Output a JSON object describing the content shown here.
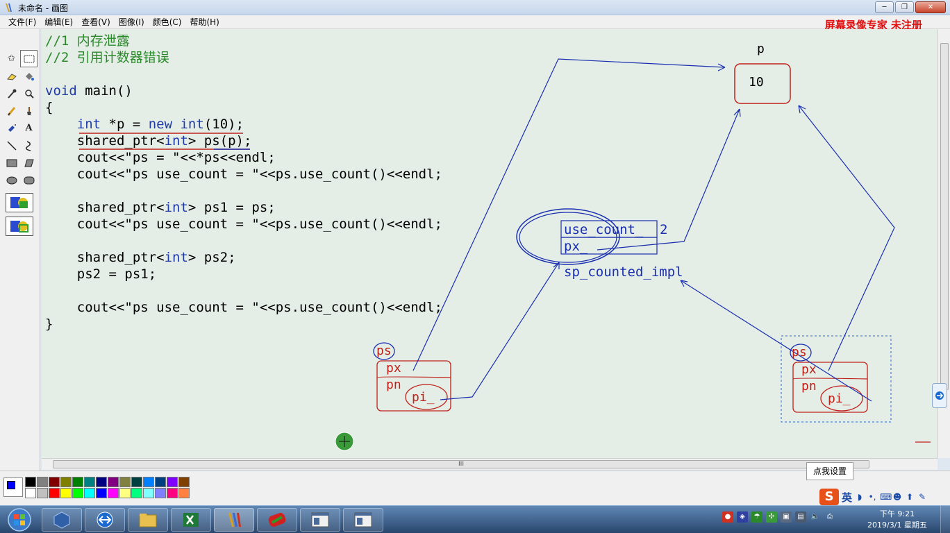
{
  "window": {
    "title": "未命名 - 画图",
    "minimize_glyph": "─",
    "restore_glyph": "❐",
    "close_glyph": "✕"
  },
  "menu": [
    "文件(F)",
    "编辑(E)",
    "查看(V)",
    "图像(I)",
    "颜色(C)",
    "帮助(H)"
  ],
  "watermark": "屏幕录像专家  未注册",
  "code_lines": [
    {
      "parts": [
        {
          "t": "//1 内存泄露",
          "c": "cmt"
        }
      ]
    },
    {
      "parts": [
        {
          "t": "//2 引用计数器错误",
          "c": "cmt"
        }
      ]
    },
    {
      "parts": []
    },
    {
      "parts": [
        {
          "t": "void",
          "c": "kw"
        },
        {
          "t": " main()",
          "c": ""
        }
      ]
    },
    {
      "parts": [
        {
          "t": "{",
          "c": ""
        }
      ]
    },
    {
      "parts": [
        {
          "t": "    ",
          "c": ""
        },
        {
          "t": "int",
          "c": "kw"
        },
        {
          "t": " *p = ",
          "c": ""
        },
        {
          "t": "new int",
          "c": "kw"
        },
        {
          "t": "(10);",
          "c": ""
        }
      ]
    },
    {
      "parts": [
        {
          "t": "    shared_ptr<",
          "c": ""
        },
        {
          "t": "int",
          "c": "kw"
        },
        {
          "t": "> ps(p);",
          "c": ""
        }
      ]
    },
    {
      "parts": [
        {
          "t": "    cout<<\"ps = \"<<*ps<<endl;",
          "c": ""
        }
      ]
    },
    {
      "parts": [
        {
          "t": "    cout<<\"ps use_count = \"<<ps.use_count()<<endl;",
          "c": ""
        }
      ]
    },
    {
      "parts": []
    },
    {
      "parts": [
        {
          "t": "    shared_ptr<",
          "c": ""
        },
        {
          "t": "int",
          "c": "kw"
        },
        {
          "t": "> ps1 = ps;",
          "c": ""
        }
      ]
    },
    {
      "parts": [
        {
          "t": "    cout<<\"ps use_count = \"<<ps.use_count()<<endl;",
          "c": ""
        }
      ]
    },
    {
      "parts": []
    },
    {
      "parts": [
        {
          "t": "    shared_ptr<",
          "c": ""
        },
        {
          "t": "int",
          "c": "kw"
        },
        {
          "t": "> ps2;",
          "c": ""
        }
      ]
    },
    {
      "parts": [
        {
          "t": "    ps2 = ps1;",
          "c": ""
        }
      ]
    },
    {
      "parts": []
    },
    {
      "parts": [
        {
          "t": "    cout<<\"ps use_count = \"<<ps.use_count()<<endl;",
          "c": ""
        }
      ]
    },
    {
      "parts": [
        {
          "t": "}",
          "c": ""
        }
      ]
    }
  ],
  "diagram": {
    "p_label": "p",
    "p_value": "10",
    "use_count_label": "use_count_",
    "use_count_value": "2",
    "px_label": "px_",
    "counted_impl_label": "sp_counted_impl",
    "left_obj": {
      "name": "ps",
      "fields": [
        "px",
        "pn",
        "pi_"
      ]
    },
    "right_obj": {
      "name": "ps",
      "fields": [
        "px",
        "pn",
        "pi_"
      ]
    }
  },
  "scroll_grip": "III",
  "tooltip": "点我设置",
  "ime": {
    "logo": "S",
    "lang": "英"
  },
  "clock": {
    "time": "下午 9:21",
    "date": "2019/3/1 星期五"
  },
  "colors": {
    "palette": [
      "#000000",
      "#808080",
      "#800000",
      "#808000",
      "#008000",
      "#008080",
      "#000080",
      "#800080",
      "#808040",
      "#004040",
      "#0080ff",
      "#004080",
      "#8000ff",
      "#804000",
      "#ffffff",
      "#c0c0c0",
      "#ff0000",
      "#ffff00",
      "#00ff00",
      "#00ffff",
      "#0000ff",
      "#ff00ff",
      "#ffff80",
      "#00ff80",
      "#80ffff",
      "#8080ff",
      "#ff0080",
      "#ff8040"
    ],
    "foreground": "#0000ff",
    "background": "#ffffff",
    "drawing_red": "#c0201a",
    "drawing_blue": "#1a2fb0"
  }
}
